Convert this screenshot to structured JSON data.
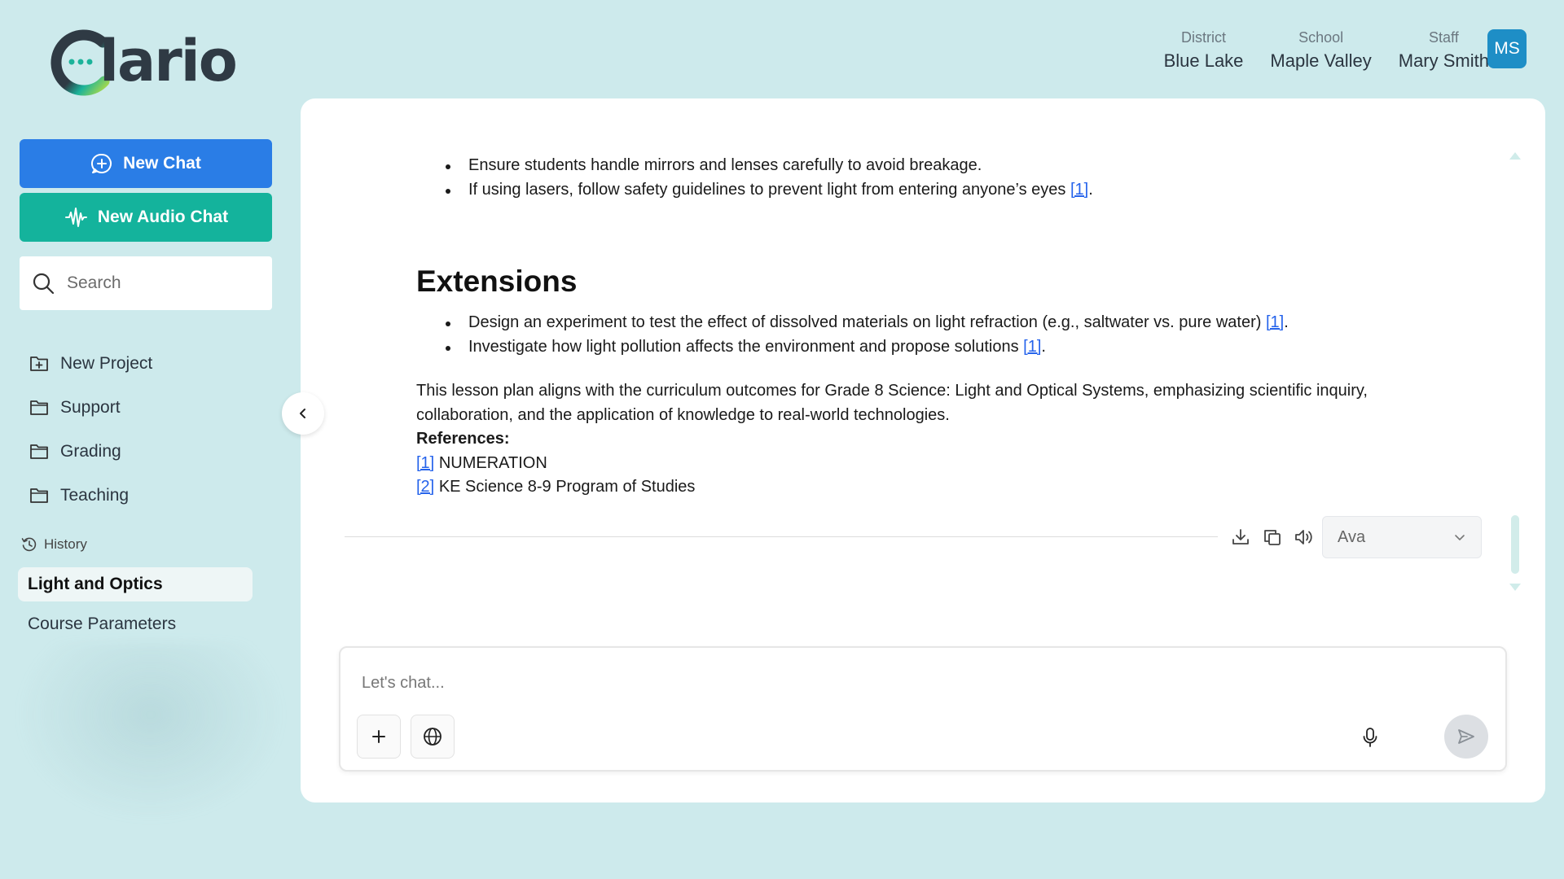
{
  "app": {
    "logo_text": "lario",
    "logo_letter": "C"
  },
  "header": {
    "district": {
      "label": "District",
      "value": "Blue Lake"
    },
    "school": {
      "label": "School",
      "value": "Maple Valley"
    },
    "staff": {
      "label": "Staff",
      "value": "Mary Smith"
    },
    "avatar_initials": "MS"
  },
  "sidebar": {
    "new_chat_label": "New Chat",
    "new_audio_chat_label": "New Audio Chat",
    "search_placeholder": "Search",
    "items": [
      {
        "label": "New Project",
        "icon": "folder-plus-icon"
      },
      {
        "label": "Support",
        "icon": "folder-icon"
      },
      {
        "label": "Grading",
        "icon": "folder-icon"
      },
      {
        "label": "Teaching",
        "icon": "folder-icon"
      }
    ],
    "history_label": "History",
    "history": [
      {
        "label": "Light and Optics",
        "active": true
      },
      {
        "label": "Course Parameters",
        "active": false
      }
    ]
  },
  "message": {
    "safety_bullets": [
      {
        "text": "Ensure students handle mirrors and lenses carefully to avoid breakage.",
        "ref": "",
        "tail": ""
      },
      {
        "text": "If using lasers, follow safety guidelines to prevent light from entering anyone’s eyes ",
        "ref": "[1]",
        "tail": "."
      }
    ],
    "extensions_heading": "Extensions",
    "extension_bullets": [
      {
        "text": "Design an experiment to test the effect of dissolved materials on light refraction (e.g., saltwater vs. pure water) ",
        "ref": "[1]",
        "tail": "."
      },
      {
        "text": "Investigate how light pollution affects the environment and propose solutions ",
        "ref": "[1]",
        "tail": "."
      }
    ],
    "summary": "This lesson plan aligns with the curriculum outcomes for Grade 8 Science: Light and Optical Systems, emphasizing scientific inquiry, collaboration, and the application of knowledge to real-world technologies.",
    "references_label": "References:",
    "references": [
      {
        "ref": "[1]",
        "title": "NUMERATION"
      },
      {
        "ref": "[2]",
        "title": "KE Science 8-9 Program of Studies"
      }
    ]
  },
  "actions": {
    "icons": [
      "download-icon",
      "copy-icon",
      "speaker-icon"
    ],
    "voice_selected": "Ava"
  },
  "composer": {
    "placeholder": "Let's chat..."
  },
  "colors": {
    "background": "#cdeaec",
    "new_chat": "#2a7de6",
    "new_audio_chat": "#14b39c",
    "avatar": "#1e8ec6",
    "link": "#2563eb"
  }
}
